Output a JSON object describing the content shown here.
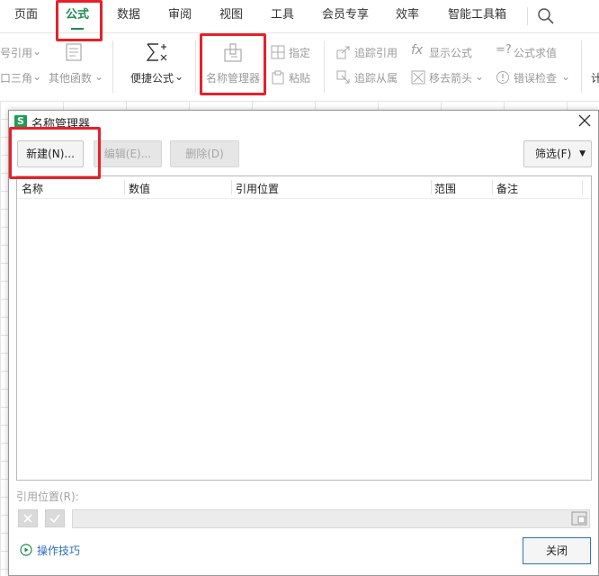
{
  "ribbon_tabs": [
    "页面",
    "公式",
    "数据",
    "审阅",
    "视图",
    "工具",
    "会员专享",
    "效率",
    "智能工具箱"
  ],
  "ribbon": {
    "quote_cut": "号引用",
    "triangle_cut": "口三角",
    "other_functions": "其他函数",
    "quick_formula": "便捷公式",
    "name_manager": "名称管理器",
    "specify": "指定",
    "paste": "粘贴",
    "trace_precedents": "追踪引用",
    "trace_dependents": "追踪从属",
    "show_formulas": "显示公式",
    "remove_arrows": "移去箭头",
    "formula_eval": "公式求值",
    "error_check": "错误检查",
    "edge_char": "计"
  },
  "dialog": {
    "title": "名称管理器",
    "app_badge": "S",
    "buttons": {
      "new": "新建(N)...",
      "edit": "编辑(E)...",
      "delete": "删除(D)",
      "filter": "筛选(F)"
    },
    "columns": [
      "名称",
      "数值",
      "引用位置",
      "范围",
      "备注"
    ],
    "ref_label": "引用位置(R):",
    "tips": "操作技巧",
    "close": "关闭"
  },
  "colors": {
    "accent": "#1e8a4c",
    "highlight": "#e8202a",
    "link": "#2e6fc0"
  }
}
